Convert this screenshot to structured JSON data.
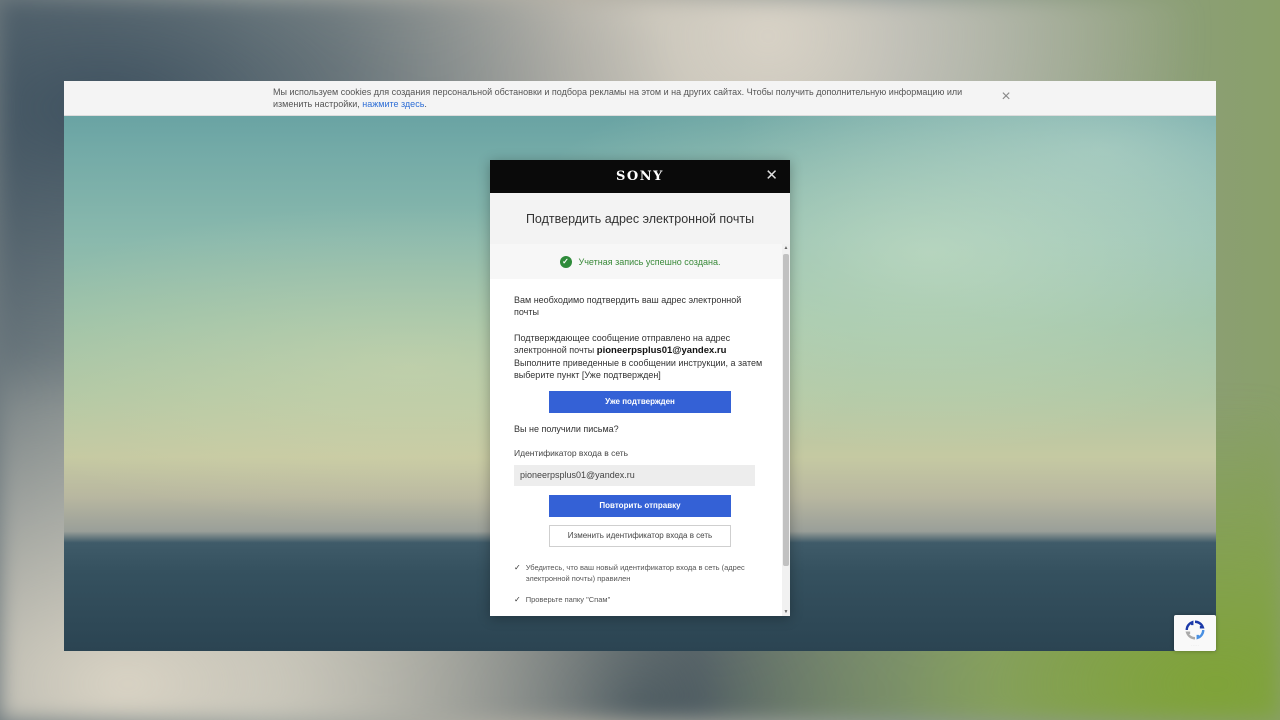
{
  "cookie_bar": {
    "text_line1": "Мы используем cookies для создания персональной обстановки и подбора рекламы на этом и на других сайтах. Чтобы получить дополнительную информацию или",
    "text_line2": "изменить настройки, ",
    "link": "нажмите здесь",
    "text_end": ".",
    "close_icon": "×"
  },
  "modal": {
    "logo": "SONY",
    "close_icon": "✕",
    "title": "Подтвердить адрес электронной почты",
    "success_message": "Учетная запись успешно создана.",
    "intro": "Вам необходимо подтвердить ваш адрес электронной почты",
    "sent_prefix": "Подтверждающее сообщение отправлено на адрес электронной почты ",
    "email": "pioneerpsplus01@yandex.ru",
    "sent_suffix": "Выполните приведенные в сообщении инструкции, а затем выберите пункт [Уже подтвержден]",
    "confirm_button": "Уже подтвержден",
    "not_received": "Вы не получили письма?",
    "signin_id_label": "Идентификатор входа в сеть",
    "signin_id_value": "pioneerpsplus01@yandex.ru",
    "resend_button": "Повторить отправку",
    "change_id_button": "Изменить идентификатор входа в сеть",
    "hints": [
      "Убедитесь, что ваш новый идентификатор входа в сеть (адрес электронной почты) правилен",
      "Проверьте папку \"Спам\""
    ]
  },
  "colors": {
    "primary_button": "#3461d6",
    "success": "#2e8b3a",
    "header": "#0a0a0a"
  }
}
